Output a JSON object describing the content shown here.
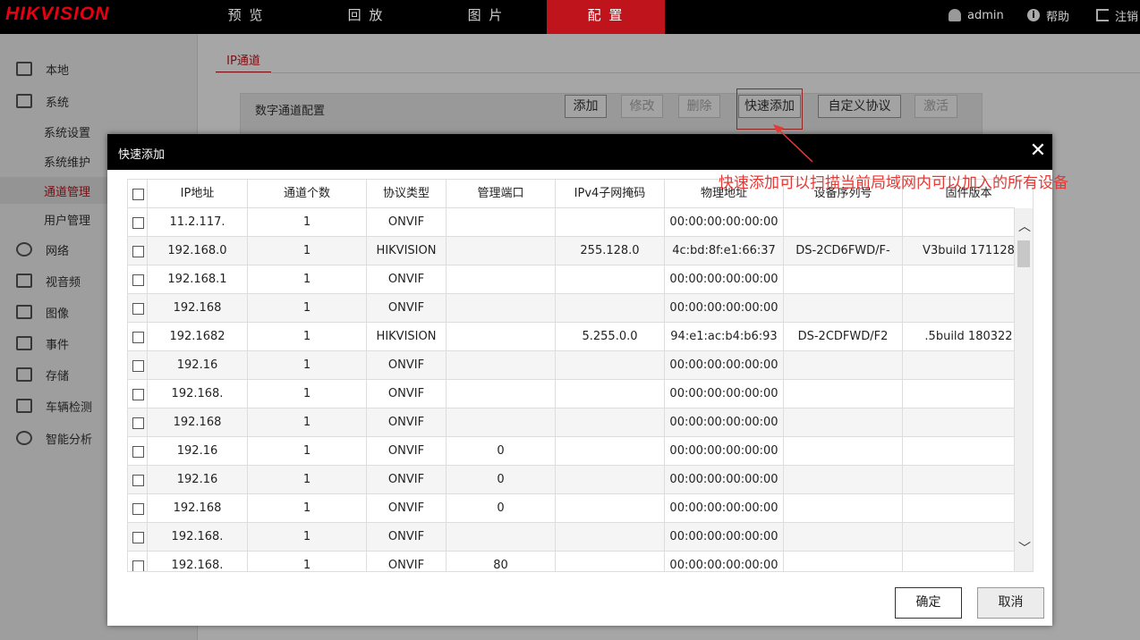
{
  "brand": "HIKVISION",
  "nav": [
    "预 览",
    "回 放",
    "图 片",
    "配 置"
  ],
  "user": {
    "name": "admin",
    "help": "帮助",
    "logout": "注销"
  },
  "sidebar": {
    "items": [
      {
        "label": "本地",
        "icon": "monitor-icon"
      },
      {
        "label": "系统",
        "icon": "system-icon"
      },
      {
        "label": "系统设置",
        "sub": true
      },
      {
        "label": "系统维护",
        "sub": true
      },
      {
        "label": "通道管理",
        "sub": true,
        "selected": true
      },
      {
        "label": "用户管理",
        "sub": true
      },
      {
        "label": "网络",
        "icon": "globe-icon"
      },
      {
        "label": "视音频",
        "icon": "audio-video-icon"
      },
      {
        "label": "图像",
        "icon": "image-icon"
      },
      {
        "label": "事件",
        "icon": "calendar-icon"
      },
      {
        "label": "存储",
        "icon": "storage-icon"
      },
      {
        "label": "车辆检测",
        "icon": "vehicle-search-icon"
      },
      {
        "label": "智能分析",
        "icon": "smart-analysis-icon"
      }
    ]
  },
  "main": {
    "tab": "IP通道",
    "panel_title": "数字通道配置",
    "buttons": {
      "add": "添加",
      "modify": "修改",
      "delete": "删除",
      "quick_add": "快速添加",
      "custom_protocol": "自定义协议",
      "activate": "激活"
    }
  },
  "dialog": {
    "title": "快速添加",
    "columns": [
      "IP地址",
      "通道个数",
      "协议类型",
      "管理端口",
      "IPv4子网掩码",
      "物理地址",
      "设备序列号",
      "固件版本"
    ],
    "rows": [
      [
        "11.2.117.",
        "1",
        "ONVIF",
        "",
        "",
        "00:00:00:00:00:00",
        "",
        ""
      ],
      [
        "192.168.0",
        "1",
        "HIKVISION",
        "",
        "255.128.0",
        "4c:bd:8f:e1:66:37",
        "DS-2CD6FWD/F-",
        "V3build 171128"
      ],
      [
        "192.168.1",
        "1",
        "ONVIF",
        "",
        "",
        "00:00:00:00:00:00",
        "",
        ""
      ],
      [
        "192.168",
        "1",
        "ONVIF",
        "",
        "",
        "00:00:00:00:00:00",
        "",
        ""
      ],
      [
        "192.1682",
        "1",
        "HIKVISION",
        "",
        "5.255.0.0",
        "94:e1:ac:b4:b6:93",
        "DS-2CDFWD/F2",
        ".5build 180322"
      ],
      [
        "192.16",
        "1",
        "ONVIF",
        "",
        "",
        "00:00:00:00:00:00",
        "",
        ""
      ],
      [
        "192.168.",
        "1",
        "ONVIF",
        "",
        "",
        "00:00:00:00:00:00",
        "",
        ""
      ],
      [
        "192.168",
        "1",
        "ONVIF",
        "",
        "",
        "00:00:00:00:00:00",
        "",
        ""
      ],
      [
        "192.16",
        "1",
        "ONVIF",
        "0",
        "",
        "00:00:00:00:00:00",
        "",
        ""
      ],
      [
        "192.16",
        "1",
        "ONVIF",
        "0",
        "",
        "00:00:00:00:00:00",
        "",
        ""
      ],
      [
        "192.168",
        "1",
        "ONVIF",
        "0",
        "",
        "00:00:00:00:00:00",
        "",
        ""
      ],
      [
        "192.168.",
        "1",
        "ONVIF",
        "",
        "",
        "00:00:00:00:00:00",
        "",
        ""
      ],
      [
        "192.168.",
        "1",
        "ONVIF",
        "80",
        "",
        "00:00:00:00:00:00",
        "",
        ""
      ]
    ],
    "ok": "确定",
    "cancel": "取消"
  },
  "annotation": "快速添加可以扫描当前局域网内可以加入的所有设备",
  "colors": {
    "accent": "#c0141c",
    "annotation": "#e53935"
  }
}
